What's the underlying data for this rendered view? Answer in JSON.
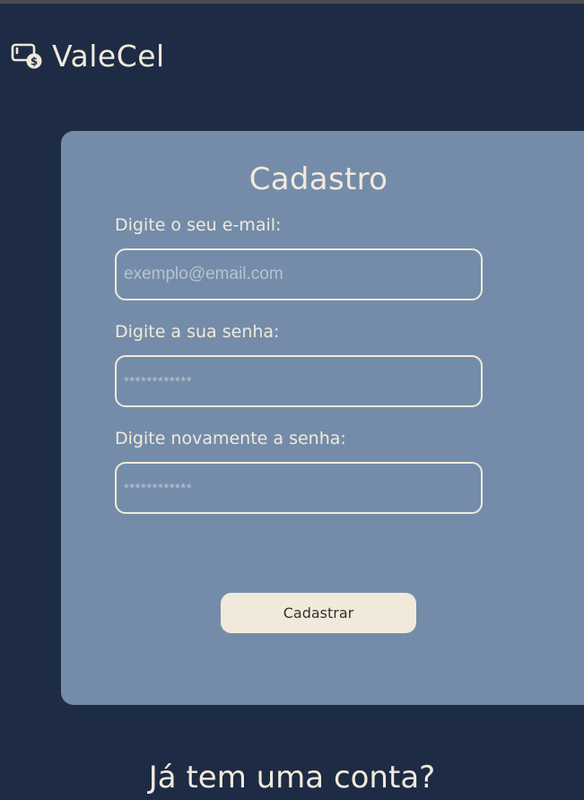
{
  "brand": {
    "name": "ValeCel",
    "icon": "wallet-dollar-icon"
  },
  "form": {
    "title": "Cadastro",
    "email": {
      "label": "Digite o seu e-mail:",
      "placeholder": "exemplo@email.com",
      "value": ""
    },
    "password": {
      "label": "Digite a sua senha:",
      "placeholder": "************",
      "value": ""
    },
    "confirm_password": {
      "label": "Digite novamente a senha:",
      "placeholder": "************",
      "value": ""
    },
    "submit_label": "Cadastrar"
  },
  "footer": {
    "login_prompt": "Já tem uma conta?"
  },
  "colors": {
    "background": "#1e2b44",
    "card": "#748ca9",
    "cream": "#f1eadb"
  }
}
